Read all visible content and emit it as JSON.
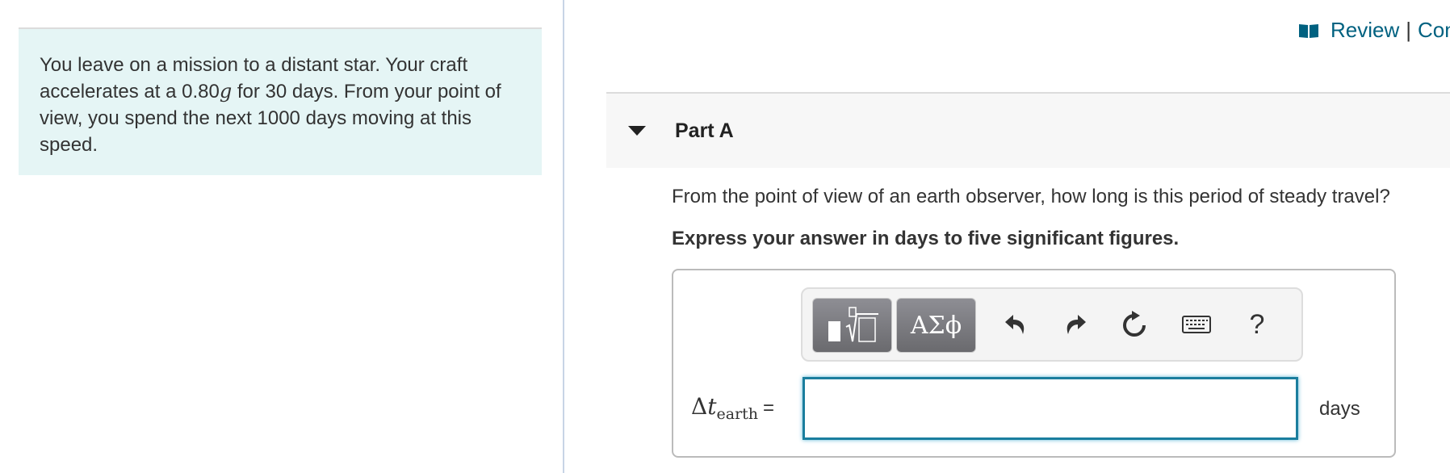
{
  "intro": {
    "text_before": "You leave on a mission to a distant star. Your craft accelerates at a 0.80",
    "math_symbol": "g",
    "text_after": " for 30 days. From your point of view, you spend the next 1000 days moving at this speed."
  },
  "header": {
    "review_label": "Review",
    "separator": "|",
    "constants_label_visible": "Con"
  },
  "part": {
    "title": "Part A",
    "question": "From the point of view of an earth observer, how long is this period of steady travel?",
    "instruction": "Express your answer in days to five significant figures."
  },
  "toolbar": {
    "templates_icon": "templates-icon",
    "symbols_label": "ΑΣϕ",
    "undo_icon": "undo-icon",
    "redo_icon": "redo-icon",
    "reset_icon": "reset-icon",
    "keyboard_icon": "keyboard-icon",
    "help_label": "?"
  },
  "answer": {
    "variable_delta": "Δ",
    "variable_t": "t",
    "variable_subscript": "earth",
    "equals": "=",
    "value": "",
    "placeholder": "",
    "units": "days"
  },
  "colors": {
    "accent": "#006180",
    "intro_bg": "#e5f5f5",
    "input_border": "#1a7e9e"
  }
}
